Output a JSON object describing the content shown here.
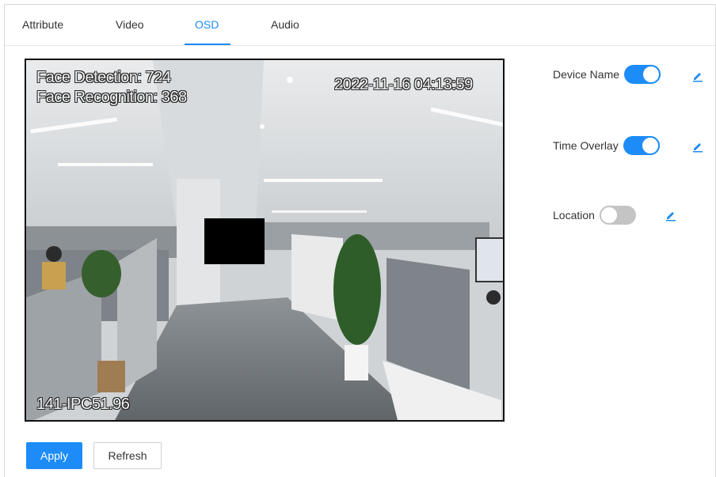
{
  "tabs": [
    {
      "label": "Attribute"
    },
    {
      "label": "Video"
    },
    {
      "label": "OSD"
    },
    {
      "label": "Audio"
    }
  ],
  "active_tab": "OSD",
  "video": {
    "overlay_line1": "Face Detection: 724",
    "overlay_line2": "Face Recognition: 368",
    "timestamp": "2022-11-16 04:13:59",
    "device_name": "141-IPC51.96"
  },
  "settings": [
    {
      "label": "Device Name",
      "enabled": true
    },
    {
      "label": "Time Overlay",
      "enabled": true
    },
    {
      "label": "Location",
      "enabled": false
    }
  ],
  "buttons": {
    "apply": "Apply",
    "refresh": "Refresh"
  },
  "colors": {
    "accent": "#1d8cf8",
    "toggle_off": "#c4c4c4"
  },
  "icons": {
    "edit": "pencil-icon"
  }
}
